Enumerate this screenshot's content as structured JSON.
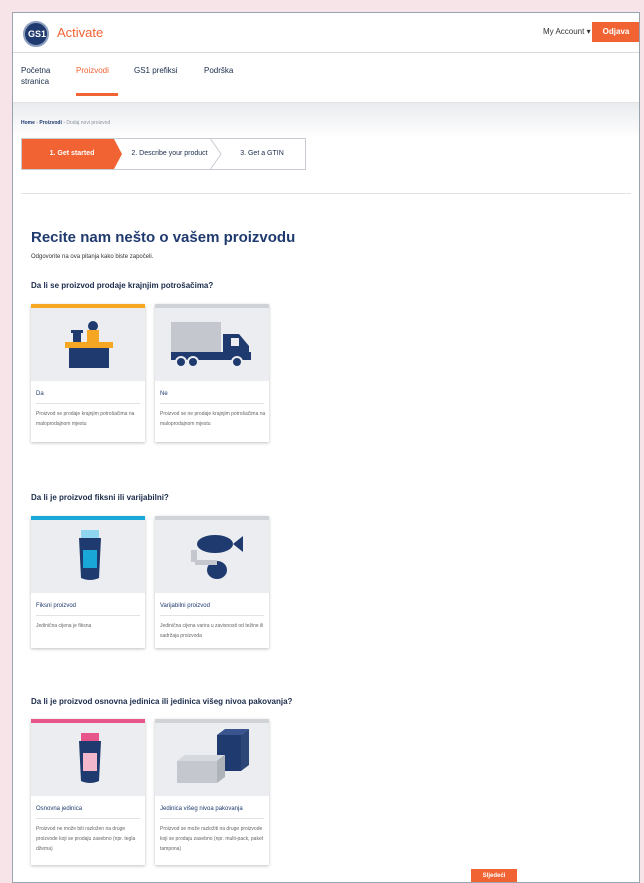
{
  "header": {
    "app_title": "Activate",
    "account_label": "My Account ▾",
    "login_label": "Odjava",
    "logo_text": "GS1"
  },
  "nav": {
    "items": [
      {
        "label": "Početna\nstranica",
        "active": false
      },
      {
        "label": "Proizvodi",
        "active": true
      },
      {
        "label": "GS1 prefiksi",
        "active": false
      },
      {
        "label": "Podrška",
        "active": false
      }
    ]
  },
  "breadcrumb": {
    "home": "Home",
    "sep1": " › ",
    "products": "Proizvodi",
    "sep2": " › ",
    "current": "Dodaj novi proizvod"
  },
  "steps": [
    {
      "label": "1. Get started",
      "active": true
    },
    {
      "label": "2. Describe your product",
      "active": false
    },
    {
      "label": "3. Get a GTIN",
      "active": false
    }
  ],
  "main": {
    "title": "Recite nam nešto o vašem proizvodu",
    "subtitle": "Odgovorite na ova pitanja kako biste započeli."
  },
  "questions": [
    {
      "label": "Da li se proizvod prodaje krajnjim potrošačima?",
      "options": [
        {
          "title": "Da",
          "description": "Proizvod se prodaje krajnjim potrošačima na maloprodajnom mjestu",
          "selected": true,
          "icon": "cashier-icon"
        },
        {
          "title": "Ne",
          "description": "Proizvod se ne prodaje krajnjim potrošačima na maloprodajnom mjestu",
          "selected": false,
          "icon": "truck-icon"
        }
      ]
    },
    {
      "label": "Da li je proizvod fiksni ili varijabilni?",
      "options": [
        {
          "title": "Fiksni proizvod",
          "description": "Jedinična cijena je fiksna",
          "selected": true,
          "icon": "can-icon"
        },
        {
          "title": "Varijabilni proizvod",
          "description": "Jedinična cijena varira u zavisnosti od težine ili sadržaja proizvoda",
          "selected": false,
          "icon": "fish-meat-icon"
        }
      ]
    },
    {
      "label": "Da li je proizvod osnovna jedinica ili jedinica višeg nivoa pakovanja?",
      "options": [
        {
          "title": "Osnovna jedinica",
          "description": "Proizvod ne može biti razložen na druge proizvode koji se prodaju zasebno (npr. tegla džema)",
          "selected": true,
          "icon": "jar-icon"
        },
        {
          "title": "Jedinica višeg nivoa pakovanja",
          "description": "Proizvod se može razložiti na druge proizvode koji se prodaju zasebno (npr. multi-pack, paket tampona)",
          "selected": false,
          "icon": "boxes-icon"
        }
      ]
    }
  ],
  "footer": {
    "next_label": "Sljedeći"
  },
  "colors": {
    "accent": "#f26334",
    "navy": "#1f3a6e",
    "yellow": "#f5a623",
    "cyan": "#19a7d8",
    "pink": "#e8558b",
    "grey_bar": "#d0d3d8"
  }
}
